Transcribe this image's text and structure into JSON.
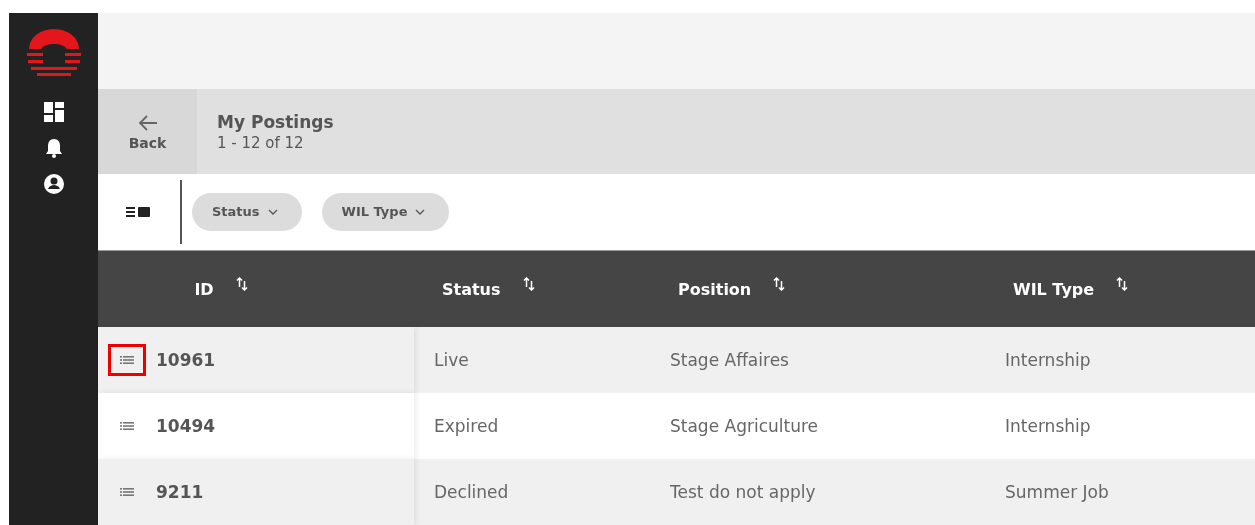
{
  "header": {
    "back_label": "Back",
    "title": "My Postings",
    "count": "1 - 12 of 12"
  },
  "filters": [
    {
      "label": "Status"
    },
    {
      "label": "WIL Type"
    }
  ],
  "table": {
    "columns": [
      "ID",
      "Status",
      "Position",
      "WIL Type"
    ],
    "rows": [
      {
        "cells": [
          "10961",
          "Live",
          "Stage Affaires",
          "Internship"
        ],
        "highlighted": true
      },
      {
        "cells": [
          "10494",
          "Expired",
          "Stage Agriculture",
          "Internship"
        ],
        "highlighted": false
      },
      {
        "cells": [
          "9211",
          "Declined",
          "Test do not apply",
          "Summer Job"
        ],
        "highlighted": false
      }
    ]
  }
}
